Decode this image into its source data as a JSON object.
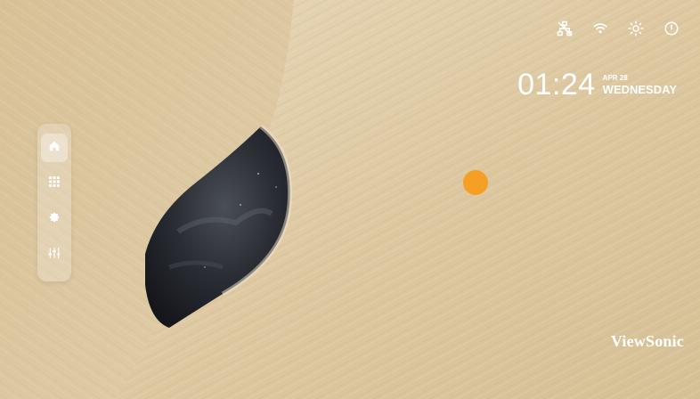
{
  "status_bar": {
    "icons": [
      "network-icon",
      "wifi-icon",
      "brightness-icon",
      "power-icon"
    ]
  },
  "clock": {
    "time": "01:24",
    "month_day": "APR 28",
    "weekday": "WEDNESDAY"
  },
  "dock": {
    "items": [
      "home-icon",
      "apps-grid-icon",
      "settings-icon",
      "adjustments-icon"
    ],
    "active": "home-icon"
  },
  "brand": {
    "name": "ViewSonic"
  },
  "colors": {
    "wood": "#ddc9a4",
    "pointer": "#f5a024",
    "text": "#ffffff"
  }
}
